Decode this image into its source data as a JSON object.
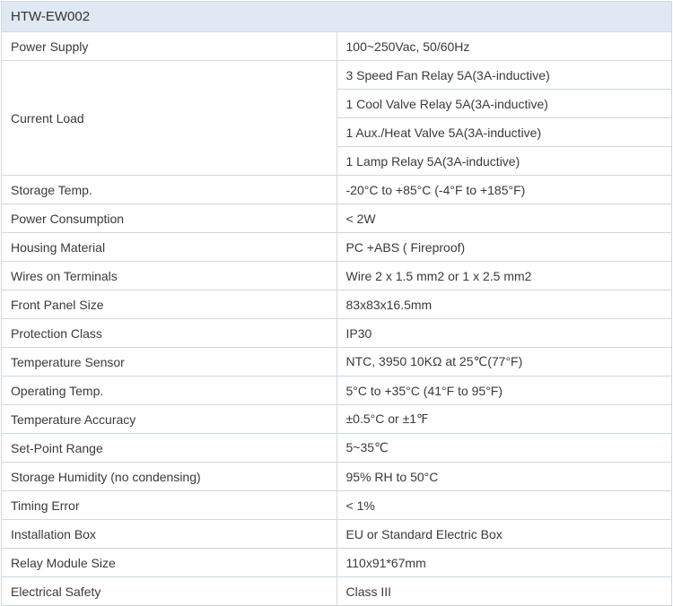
{
  "table": {
    "title": "HTW-EW002",
    "rows": [
      {
        "label": "Power Supply",
        "values": [
          "100~250Vac, 50/60Hz"
        ]
      },
      {
        "label": "Current Load",
        "values": [
          "3 Speed Fan Relay 5A(3A-inductive)",
          "1 Cool Valve Relay 5A(3A-inductive)",
          "1 Aux./Heat Valve 5A(3A-inductive)",
          "1 Lamp Relay 5A(3A-inductive)"
        ]
      },
      {
        "label": "Storage Temp.",
        "values": [
          "-20°C to +85°C (-4°F to +185°F)"
        ]
      },
      {
        "label": "Power Consumption",
        "values": [
          "< 2W"
        ]
      },
      {
        "label": "Housing Material",
        "values": [
          "PC +ABS ( Fireproof)"
        ]
      },
      {
        "label": "Wires on Terminals",
        "values": [
          "Wire 2 x 1.5 mm2 or 1 x 2.5 mm2"
        ]
      },
      {
        "label": "Front Panel Size",
        "values": [
          "83x83x16.5mm"
        ]
      },
      {
        "label": "Protection Class",
        "values": [
          "IP30"
        ]
      },
      {
        "label": "Temperature Sensor",
        "values": [
          "NTC, 3950 10KΩ at 25℃(77°F)"
        ]
      },
      {
        "label": "Operating Temp.",
        "values": [
          "5°C to +35°C (41°F to 95°F)"
        ]
      },
      {
        "label": "Temperature Accuracy",
        "values": [
          "±0.5°C or ±1℉"
        ]
      },
      {
        "label": "Set-Point Range",
        "values": [
          "5~35℃"
        ]
      },
      {
        "label": "Storage Humidity (no condensing)",
        "values": [
          "95% RH to 50°C"
        ]
      },
      {
        "label": "Timing Error",
        "values": [
          "< 1%"
        ]
      },
      {
        "label": "Installation Box",
        "values": [
          "EU or Standard Electric Box"
        ]
      },
      {
        "label": "Relay Module Size",
        "values": [
          "110x91*67mm"
        ]
      },
      {
        "label": "Electrical Safety",
        "values": [
          "Class III"
        ]
      }
    ]
  },
  "colors": {
    "header_background": "#dfe8f3",
    "border": "#cfd8e3",
    "text": "#3a3a3a"
  }
}
